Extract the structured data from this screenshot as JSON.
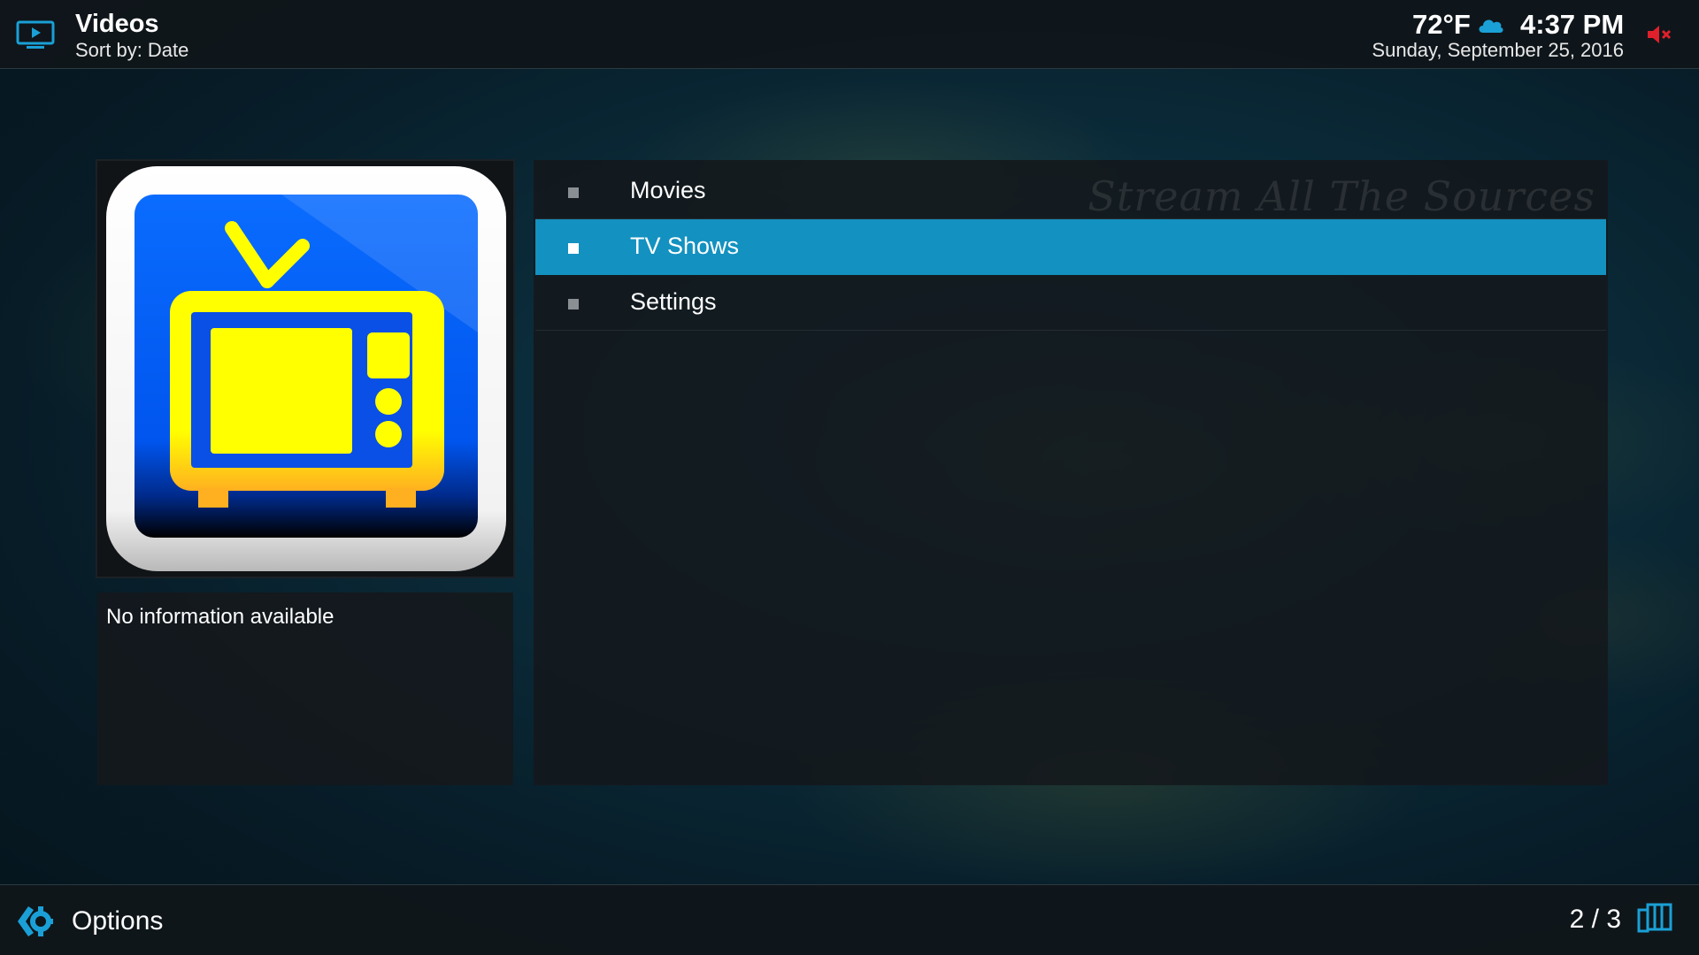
{
  "header": {
    "title": "Videos",
    "sort_label": "Sort by: Date",
    "temperature": "72°F",
    "weather_icon": "cloud-icon",
    "time": "4:37 PM",
    "date": "Sunday, September 25, 2016",
    "mute_icon": "muted-speaker-icon"
  },
  "thumbnail": {
    "icon": "tv-icon",
    "colors": {
      "tile_bg": "#0066ff",
      "tv_body": "#ffff00",
      "frame": "#ffffff"
    }
  },
  "info": {
    "text": "No information available"
  },
  "list": {
    "watermark": "Stream All The Sources",
    "items": [
      {
        "label": "Movies",
        "selected": false
      },
      {
        "label": "TV Shows",
        "selected": true
      },
      {
        "label": "Settings",
        "selected": false
      }
    ]
  },
  "footer": {
    "options_label": "Options",
    "page_indicator": "2 / 3",
    "view_icon": "view-mode-icon"
  },
  "colors": {
    "accent": "#1391c0",
    "bar_bg": "#10161a",
    "mute_red": "#e0202a"
  }
}
